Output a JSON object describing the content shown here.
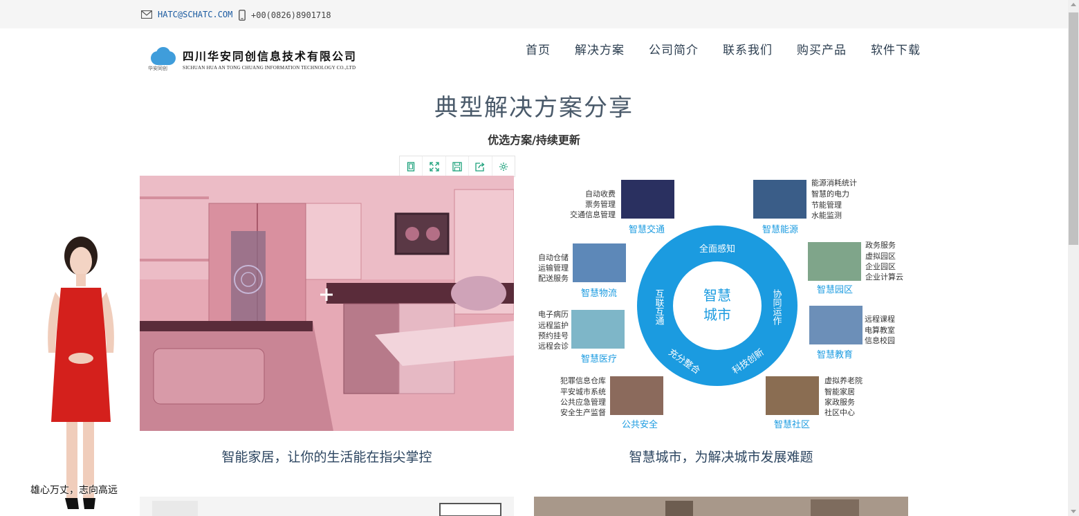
{
  "topbar": {
    "email": "HATC@SCHATC.COM",
    "phone": "+00(0826)8901718"
  },
  "logo": {
    "cn_name": "四川华安同创信息技术有限公司",
    "en_name": "SICHUAN HUA AN TONG CHUANG INFORMATION TECHNOLOGY CO.,LTD",
    "sub": "华安同创"
  },
  "nav": {
    "items": [
      {
        "label": "首页"
      },
      {
        "label": "解决方案"
      },
      {
        "label": "公司简介"
      },
      {
        "label": "联系我们"
      },
      {
        "label": "购买产品"
      },
      {
        "label": "软件下载"
      }
    ]
  },
  "section": {
    "title": "典型解决方案分享",
    "subtitle": "优选方案/持续更新"
  },
  "toolbar": {
    "icons": [
      "page-icon",
      "fullscreen-icon",
      "save-icon",
      "share-icon",
      "settings-icon"
    ]
  },
  "cards": [
    {
      "caption": "智能家居，让你的生活能在指尖掌控"
    },
    {
      "caption": "智慧城市，为解决城市发展难题"
    }
  ],
  "smart_city": {
    "center_line1": "智慧",
    "center_line2": "城市",
    "ring_top": "全面感知",
    "ring_left": "互联互通",
    "ring_right": "协同运作",
    "ring_bottom_left": "充分整合",
    "ring_bottom_right": "科技创新",
    "nodes": [
      {
        "title": "智慧交通",
        "lines": [
          "自动收费",
          "票务管理",
          "交通信息管理"
        ]
      },
      {
        "title": "智慧能源",
        "lines": [
          "能源消耗统计",
          "智慧的电力",
          "节能管理",
          "水能监测"
        ]
      },
      {
        "title": "智慧物流",
        "lines": [
          "自动仓储",
          "运输管理",
          "配送服务"
        ]
      },
      {
        "title": "智慧园区",
        "lines": [
          "政务服务",
          "虚拟园区",
          "企业园区",
          "企业计算云"
        ]
      },
      {
        "title": "智慧医疗",
        "lines": [
          "电子病历",
          "远程监护",
          "预约挂号",
          "远程会诊"
        ]
      },
      {
        "title": "智慧教育",
        "lines": [
          "远程课程",
          "电算教室",
          "信息校园"
        ]
      },
      {
        "title": "公共安全",
        "lines": [
          "犯罪信息仓库",
          "平安城市系统",
          "公共应急管理",
          "安全生产监督"
        ]
      },
      {
        "title": "智慧社区",
        "lines": [
          "虚拟养老院",
          "智能家居",
          "家政服务",
          "社区中心"
        ]
      }
    ]
  },
  "avatar": {
    "caption": "雄心万丈，志向高远"
  },
  "colors": {
    "nav_text": "#2c3e50",
    "accent_blue": "#1aa0e0",
    "toolbar_green": "#1aa07a",
    "pink_overlay": "#e8a8b4"
  }
}
